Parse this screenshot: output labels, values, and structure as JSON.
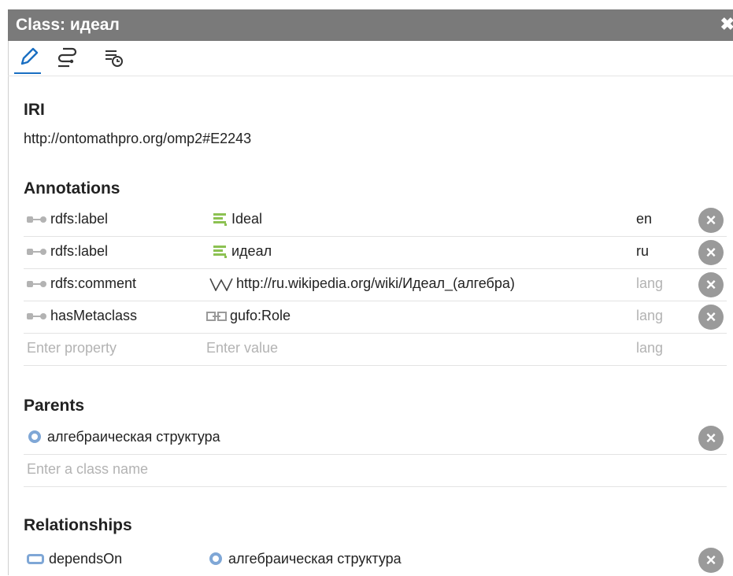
{
  "window": {
    "title": "Class: идеал",
    "close_glyph": "✖"
  },
  "toolbar": {
    "icons": [
      "pencil-icon",
      "path-icon",
      "history-icon"
    ]
  },
  "iri": {
    "heading": "IRI",
    "value": "http://ontomathpro.org/omp2#E2243"
  },
  "annotations": {
    "heading": "Annotations",
    "rows": [
      {
        "property": "rdfs:label",
        "value_icon": "literal-icon",
        "value": "Ideal",
        "lang": "en"
      },
      {
        "property": "rdfs:label",
        "value_icon": "literal-icon",
        "value": "идеал",
        "lang": "ru"
      },
      {
        "property": "rdfs:comment",
        "value_icon": "wikipedia-icon",
        "value": "http://ru.wikipedia.org/wiki/Идеал_(алгебра)",
        "lang": "lang"
      },
      {
        "property": "hasMetaclass",
        "value_icon": "individual-icon",
        "value": "gufo:Role",
        "lang": "lang"
      }
    ],
    "new_row": {
      "property_placeholder": "Enter property",
      "value_placeholder": "Enter value",
      "lang_placeholder": "lang"
    }
  },
  "parents": {
    "heading": "Parents",
    "items": [
      {
        "label": "алгебраическая структура"
      }
    ],
    "placeholder": "Enter a class name"
  },
  "relationships": {
    "heading": "Relationships",
    "rows": [
      {
        "property": "dependsOn",
        "target": "алгебраическая структура"
      }
    ]
  },
  "colors": {
    "titlebar": "#7a7a7a",
    "accent": "#1a6fc2",
    "literal": "#8cc152",
    "class": "#7fa7d6",
    "remove": "#9a9a9a"
  }
}
